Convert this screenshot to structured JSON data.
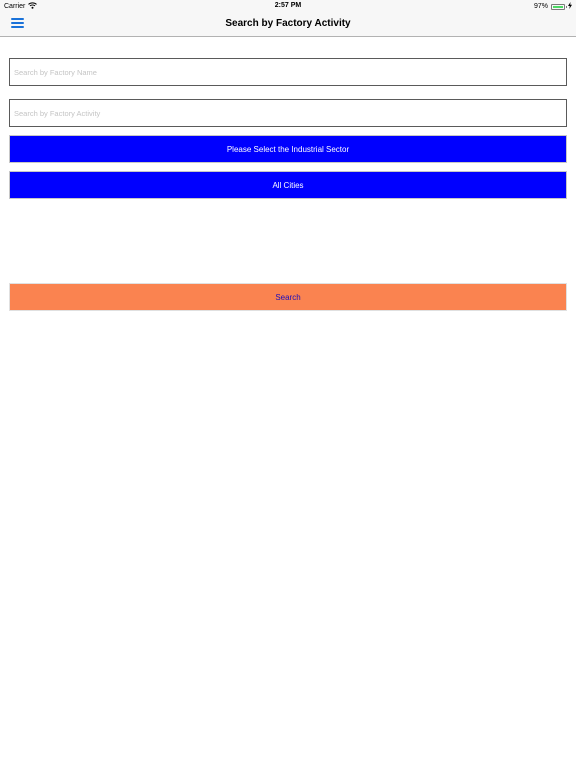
{
  "status_bar": {
    "carrier": "Carrier",
    "time": "2:57 PM",
    "battery_percent": "97%",
    "battery_level": 0.97,
    "wifi_icon": "wifi-icon",
    "charging_icon": "charging-bolt-icon"
  },
  "nav": {
    "title": "Search by Factory Activity",
    "menu_icon": "hamburger-menu-icon"
  },
  "form": {
    "factory_name_placeholder": "Search by Factory Name",
    "factory_name_value": "",
    "factory_activity_placeholder": "Search by Factory Activity",
    "factory_activity_value": "",
    "sector_label": "Please Select the Industrial Sector",
    "cities_label": "All Cities",
    "search_label": "Search"
  },
  "colors": {
    "primary_button": "#0000ff",
    "search_button": "#fa8350",
    "search_text": "#1a0dbd",
    "menu_icon": "#1a72d9",
    "battery": "#4cd964"
  }
}
